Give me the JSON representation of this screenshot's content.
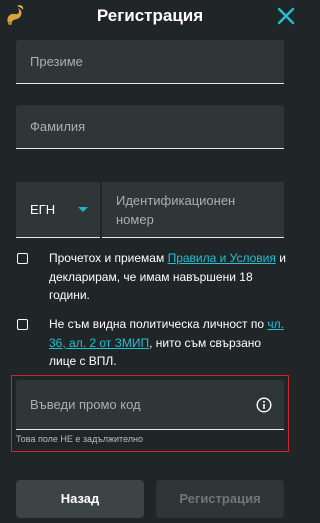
{
  "header": {
    "title": "Регистрация",
    "logo_icon": "gold-scorpion-logo",
    "close_icon": "close-x"
  },
  "form": {
    "surname_placeholder": "Презиме",
    "lastname_placeholder": "Фамилия",
    "id_type": "ЕГН",
    "id_placeholder": "Идентификационен номер",
    "terms": {
      "text_before": "Прочетох и приемам ",
      "link": "Правила и Условия",
      "text_after": " и декларирам, че имам навършени 18 години."
    },
    "pep": {
      "text_before": "Не съм видна политическа личност по ",
      "link": "чл. 36, ал. 2 от ЗМИП",
      "text_after": ", нито съм свързано лице с ВПЛ."
    },
    "promo_placeholder": "Въведи промо код",
    "promo_helper": "Това поле НЕ е задължително"
  },
  "buttons": {
    "back": "Назад",
    "register": "Регистрация"
  },
  "colors": {
    "background": "#202628",
    "accent": "#1fc1d2",
    "error": "#c62828",
    "field": "#2e3638"
  }
}
